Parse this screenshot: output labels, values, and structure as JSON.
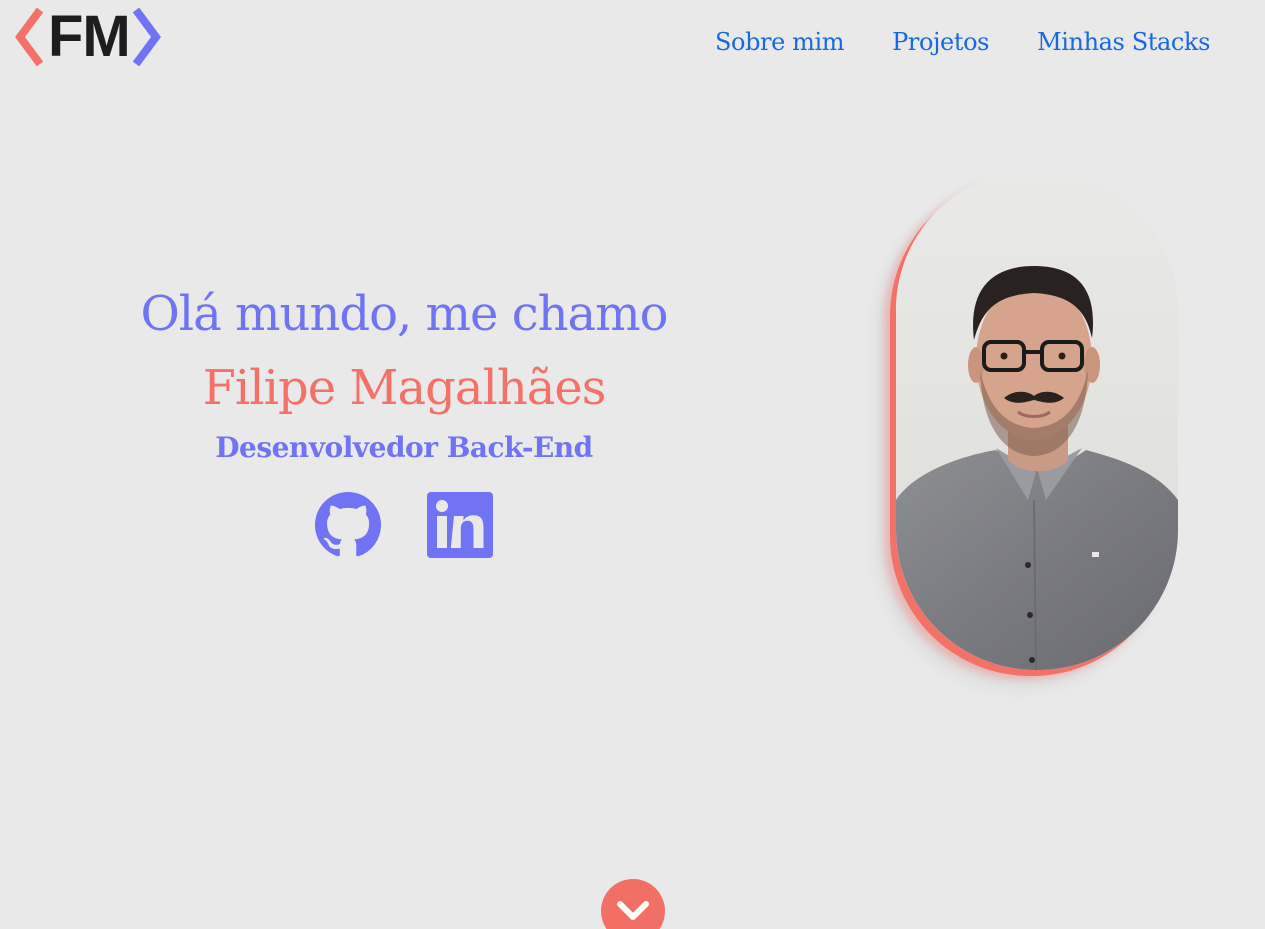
{
  "header": {
    "logo_text": "FM",
    "nav": [
      {
        "label": "Sobre mim"
      },
      {
        "label": "Projetos"
      },
      {
        "label": "Minhas Stacks"
      }
    ]
  },
  "hero": {
    "greeting": "Olá mundo, me chamo",
    "name": "Filipe Magalhães",
    "role": "Desenvolvedor Back-End",
    "socials": [
      {
        "icon": "github-icon"
      },
      {
        "icon": "linkedin-icon"
      }
    ]
  },
  "profile_photo": {
    "description_icon": "profile-photo"
  },
  "scroll_button": {
    "icon": "chevron-down-icon"
  },
  "colors": {
    "background": "#e9e9ea",
    "primary": "#6f73f4",
    "accent": "#f47168",
    "nav_link": "#1769e0",
    "logo_dark": "#1d1d1d"
  }
}
